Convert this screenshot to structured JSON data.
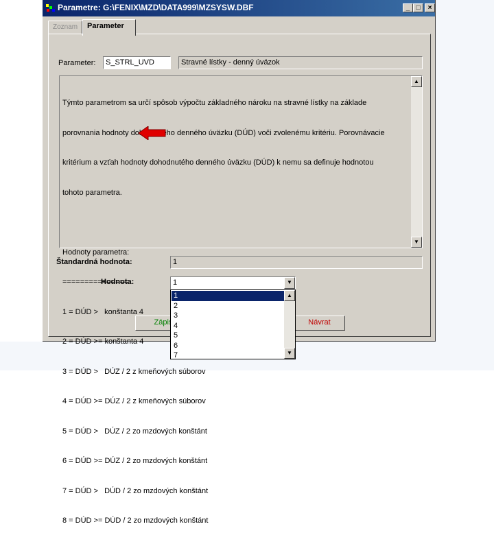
{
  "window": {
    "title": "Parametre: G:\\FENIX\\MZD\\DATA999\\MZSYSW.DBF",
    "controls": {
      "minimize": "_",
      "maximize": "□",
      "close": "×"
    }
  },
  "tabs": [
    {
      "label": "Zoznam",
      "active": false
    },
    {
      "label": "Parameter",
      "active": true
    }
  ],
  "parameter": {
    "label": "Parameter:",
    "code": "S_STRL_UVD",
    "description": "Stravné lístky - denný úväzok"
  },
  "memo_lines": [
    "Týmto parametrom sa určí spôsob výpočtu základného nároku na stravné lístky na základe",
    "porovnania hodnoty dohodnutého denného úväzku (DÚD) voči zvolenému kritériu. Porovnávacie",
    "kritérium a vzťah hodnoty dohodnutého denného úväzku (DÚD) k nemu sa definuje hodnotou",
    "tohoto parametra.",
    "",
    "Hodnoty parametra:",
    "===============",
    "1 = DÚD >   konštanta 4",
    "2 = DÚD >= konštanta 4",
    "3 = DÚD >   DÚZ / 2 z kmeňových súborov",
    "4 = DÚD >= DÚZ / 2 z kmeňových súborov",
    "5 = DÚD >   DÚZ / 2 zo mzdových konštánt",
    "6 = DÚD >= DÚZ / 2 zo mzdových konštánt",
    "7 = DÚD >   DÚD / 2 zo mzdových konštánt",
    "8 = DÚD >= DÚD / 2 zo mzdových konštánt"
  ],
  "standard": {
    "label": "Štandardná hodnota:",
    "value": "1"
  },
  "hodnota": {
    "label": "Hodnota:",
    "value": "1",
    "options": [
      "1",
      "2",
      "3",
      "4",
      "5",
      "6",
      "7"
    ],
    "selected_index": 0
  },
  "buttons": {
    "save": "Zápis",
    "back": "Návrat"
  },
  "colors": {
    "title_bar": "#0a246a",
    "selection": "#0a246a",
    "arrow": "#e00000",
    "save_text": "#008000",
    "back_text": "#c00000"
  }
}
